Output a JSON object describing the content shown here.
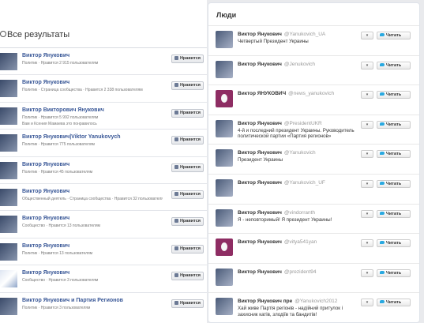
{
  "fb": {
    "title": "Все результаты",
    "rows": [
      {
        "name": "Виктор Янукович",
        "sub": "Политик · Нравится 2 915 пользователям",
        "sub2": "",
        "btn": "Нравится",
        "avatar": "dark"
      },
      {
        "name": "Виктор Янукович",
        "sub": "Политик · Страница сообщества · Нравится 2 338 пользователям",
        "sub2": "",
        "btn": "Нравится",
        "avatar": "dark"
      },
      {
        "name": "Виктор Викторович Янукович",
        "sub": "Политик · Нравится 5 992 пользователям",
        "sub2": "Вам и Ксения Мамаева это понравилось",
        "btn": "Нравится",
        "avatar": "dark"
      },
      {
        "name": "Виктор Янукович|Viktor Yanukovych",
        "sub": "Политик · Нравится 775 пользователям",
        "sub2": "",
        "btn": "Нравится",
        "avatar": "dark"
      },
      {
        "name": "Виктор Янукович",
        "sub": "Политик · Нравится 45 пользователям",
        "sub2": "",
        "btn": "Нравится",
        "avatar": "dark"
      },
      {
        "name": "Виктор Янукович",
        "sub": "Общественный деятель · Страница сообщества · Нравится 32 пользователям",
        "sub2": "",
        "btn": "Нравится",
        "avatar": "dark"
      },
      {
        "name": "Виктор Янукович",
        "sub": "Сообщество · Нравится 13 пользователям",
        "sub2": "",
        "btn": "Нравится",
        "avatar": "dark"
      },
      {
        "name": "Виктор Янукович",
        "sub": "Политик · Нравится 13 пользователям",
        "sub2": "",
        "btn": "Нравится",
        "avatar": "dark"
      },
      {
        "name": "Виктор Янукович",
        "sub": "Сообщество · Нравится 3 пользователям",
        "sub2": "",
        "btn": "Нравится",
        "avatar": "flag"
      },
      {
        "name": "Виктор Янукович и Партия Регионов",
        "sub": "Политик · Нравится 3 пользователям",
        "sub2": "",
        "btn": "Нравится",
        "avatar": "dark"
      }
    ]
  },
  "tw": {
    "title": "Люди",
    "user_btn": "▾",
    "rows": [
      {
        "name": "Виктор Янукович",
        "handle": "@Yanukovich_UA",
        "bio": "Четвертый Президент Украины",
        "follow": "Читать",
        "egg": false
      },
      {
        "name": "Виктор Янукович",
        "handle": "@Jenukovich",
        "bio": "",
        "follow": "Читать",
        "egg": false
      },
      {
        "name": "Виктор ЯНУКОВИЧ",
        "handle": "@news_yanukovich",
        "bio": "",
        "follow": "Читать",
        "egg": true
      },
      {
        "name": "Виктор Янукович",
        "handle": "@PresidentUKR",
        "bio": "4-й и последний президент Украины. Руководитель политической партии «Партия регионов»",
        "follow": "Читать",
        "egg": false
      },
      {
        "name": "Виктор Янукович",
        "handle": "@Yanukovich",
        "bio": "Президент Украины",
        "follow": "Читать",
        "egg": false
      },
      {
        "name": "Виктор Янукович",
        "handle": "@Yanukovich_UF",
        "bio": "",
        "follow": "Читать",
        "egg": false
      },
      {
        "name": "Виктор Янукович",
        "handle": "@vindorranth",
        "bio": "Я - неповторимый! Я президент Украины!",
        "follow": "Читать",
        "egg": false
      },
      {
        "name": "Виктор Янукович",
        "handle": "@vitya541yan",
        "bio": "",
        "follow": "Читать",
        "egg": true
      },
      {
        "name": "Виктор Янукович",
        "handle": "@prezident94",
        "bio": "",
        "follow": "Читать",
        "egg": false
      },
      {
        "name": "Виктор Янукович пре",
        "handle": "@Yanukovich2012",
        "bio": "Хай живе Партія регіонів - надійний притулок і захисник катів, злодіїв та бандитів!",
        "follow": "Читать",
        "egg": false
      }
    ]
  }
}
